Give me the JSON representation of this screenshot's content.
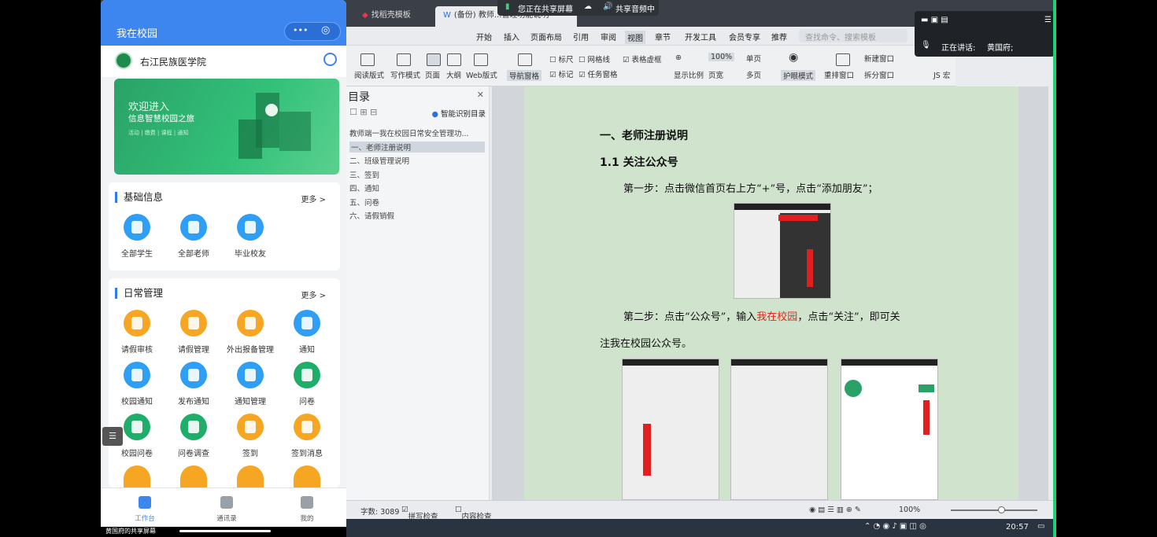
{
  "phone": {
    "title": "我在校园",
    "capsule_more": "•••",
    "school_name": "右江民族医学院",
    "banner": {
      "line1": "欢迎进入",
      "line2": "信息智慧校园之旅",
      "line3": "活动 | 缴费 | 课程 | 通知"
    },
    "basic": {
      "title": "基础信息",
      "more": "更多 >",
      "items": [
        {
          "label": "全部学生",
          "icon": "graduation-cap-icon",
          "color": "#2f9ef5"
        },
        {
          "label": "全部老师",
          "icon": "teacher-icon",
          "color": "#2f9ef5"
        },
        {
          "label": "毕业校友",
          "icon": "aperture-icon",
          "color": "#2f9ef5"
        }
      ]
    },
    "daily": {
      "title": "日常管理",
      "more": "更多 >",
      "items": [
        {
          "label": "请假审核",
          "icon": "leave-review-icon",
          "color": "#f6a623"
        },
        {
          "label": "请假管理",
          "icon": "leave-manage-icon",
          "color": "#f6a623"
        },
        {
          "label": "外出报备管理",
          "icon": "outing-icon",
          "color": "#f6a623"
        },
        {
          "label": "通知",
          "icon": "notice-icon",
          "color": "#2f9ef5"
        },
        {
          "label": "校园通知",
          "icon": "campus-notice-icon",
          "color": "#2f9ef5"
        },
        {
          "label": "发布通知",
          "icon": "publish-notice-icon",
          "color": "#2f9ef5"
        },
        {
          "label": "通知管理",
          "icon": "notice-manage-icon",
          "color": "#2f9ef5"
        },
        {
          "label": "问卷",
          "icon": "questionnaire-icon",
          "color": "#1fae6a"
        },
        {
          "label": "校园问卷",
          "icon": "campus-questionnaire-icon",
          "color": "#1fae6a"
        },
        {
          "label": "问卷调查",
          "icon": "survey-icon",
          "color": "#1fae6a"
        },
        {
          "label": "签到",
          "icon": "checkin-icon",
          "color": "#f6a623"
        },
        {
          "label": "签到消息",
          "icon": "checkin-message-icon",
          "color": "#f6a623"
        }
      ]
    },
    "nav": [
      {
        "label": "工作台",
        "icon": "workbench-icon"
      },
      {
        "label": "通讯录",
        "icon": "contacts-icon"
      },
      {
        "label": "我的",
        "icon": "profile-icon"
      }
    ],
    "share_caption": "黄国府的共享屏幕"
  },
  "wps": {
    "share_banner": "您正在共享屏幕",
    "share_audio": "共享音频中",
    "tabs": [
      "找稻壳模板",
      "(备份) 教师...管理功能说明"
    ],
    "menus": [
      "开始",
      "插入",
      "页面布局",
      "引用",
      "审阅",
      "视图",
      "章节",
      "开发工具",
      "会员专享",
      "推荐"
    ],
    "search_placeholder": "查找命令、搜索模板",
    "ribbon": {
      "modes": [
        "阅读版式",
        "写作模式",
        "页面",
        "大纲",
        "Web版式"
      ],
      "nav_pane": "导航窗格",
      "checks": [
        "标尺",
        "网格线",
        "表格虚框",
        "标记",
        "任务窗格"
      ],
      "zoom_items": [
        "显示比例",
        "100%",
        "单页",
        "页宽",
        "多页"
      ],
      "eye_mode": "护眼模式",
      "windows": [
        "重排窗口",
        "新建窗口",
        "拆分窗口"
      ],
      "macro": "JS 宏"
    },
    "nav": {
      "title": "目录",
      "smart": "智能识别目录",
      "items": [
        "教师端一我在校园日常安全管理功...",
        "一、老师注册说明",
        "二、班级管理说明",
        "三、签到",
        "四、通知",
        "五、问卷",
        "六、请假销假"
      ]
    },
    "doc": {
      "h1": "一、老师注册说明",
      "h2": "1.1 关注公众号",
      "step1": "第一步：点击微信首页右上方“+”号，点击“添加朋友”；",
      "step2_a": "第二步：点击“公众号”，输入",
      "step2_hl": "我在校园",
      "step2_b": "，点击“关注”，即可关",
      "step2_c": "注我在校园公众号。",
      "highlight_color": "#e8261b"
    },
    "status": {
      "words": "字数: 3089",
      "spell": "拼写检查",
      "content": "内容检查",
      "zoom": "100%"
    }
  },
  "call": {
    "speaking": "正在讲话:",
    "speaker": "黄国府;"
  },
  "taskbar": {
    "time": "20:57"
  }
}
